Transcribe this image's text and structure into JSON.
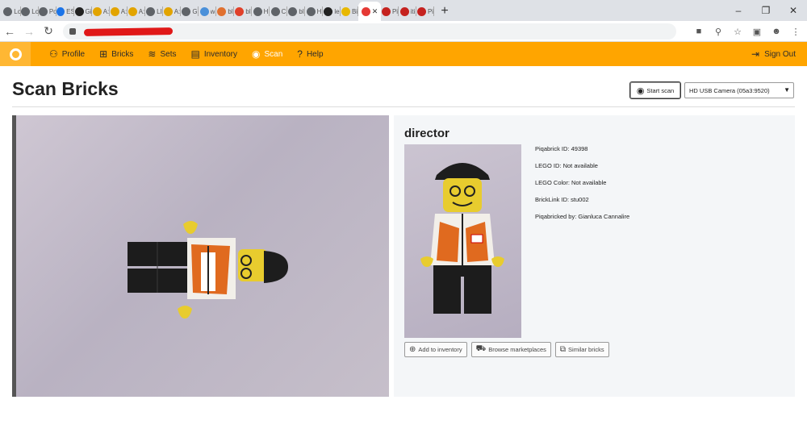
{
  "browser": {
    "tabs": [
      {
        "label": "Lc",
        "color": "#5f6368"
      },
      {
        "label": "Lc",
        "color": "#5f6368"
      },
      {
        "label": "Pc",
        "color": "#5f6368"
      },
      {
        "label": "ES",
        "color": "#1a73e8"
      },
      {
        "label": "Gi",
        "color": "#222222"
      },
      {
        "label": "A:",
        "color": "#e2a400"
      },
      {
        "label": "A:",
        "color": "#e2a400"
      },
      {
        "label": "A:",
        "color": "#e2a400"
      },
      {
        "label": "LI",
        "color": "#5f6368"
      },
      {
        "label": "A:",
        "color": "#e2a400"
      },
      {
        "label": "G",
        "color": "#5f6368"
      },
      {
        "label": "w",
        "color": "#4a90d9"
      },
      {
        "label": "bl",
        "color": "#e07030"
      },
      {
        "label": "bl",
        "color": "#e0402a"
      },
      {
        "label": "H",
        "color": "#5f6368"
      },
      {
        "label": "C",
        "color": "#5f6368"
      },
      {
        "label": "bl",
        "color": "#5f6368"
      },
      {
        "label": "H",
        "color": "#5f6368"
      },
      {
        "label": "le",
        "color": "#222222"
      },
      {
        "label": "Bi",
        "color": "#e8b800"
      }
    ],
    "active_tab_color": "#e53935",
    "trailing_tabs": [
      {
        "label": "Pi",
        "color": "#c5221f"
      },
      {
        "label": "iti",
        "color": "#c5221f"
      },
      {
        "label": "Pi",
        "color": "#c5221f"
      }
    ],
    "new_tab": "+",
    "window_controls": {
      "minimize": "–",
      "maximize": "❐",
      "close": "✕"
    }
  },
  "nav": {
    "items": [
      {
        "label": "Profile",
        "icon": "person-icon",
        "glyph": "⚇"
      },
      {
        "label": "Bricks",
        "icon": "grid-icon",
        "glyph": "⊞"
      },
      {
        "label": "Sets",
        "icon": "layers-icon",
        "glyph": "≋"
      },
      {
        "label": "Inventory",
        "icon": "archive-icon",
        "glyph": "▤"
      },
      {
        "label": "Scan",
        "icon": "eye-icon",
        "glyph": "◉"
      },
      {
        "label": "Help",
        "icon": "help-icon",
        "glyph": "?"
      }
    ],
    "active": "Scan",
    "signout": "Sign Out",
    "signout_icon": "⇥",
    "accent": "#ffa500"
  },
  "page": {
    "title": "Scan Bricks",
    "start_scan": "Start scan",
    "camera": "HD USB Camera (05a3:9520)"
  },
  "brick": {
    "name": "director",
    "details": [
      "Piqabrick ID: 49398",
      "LEGO ID: Not available",
      "LEGO Color: Not available",
      "BrickLink ID: stu002",
      "Piqabricked by: Gianluca Cannalire"
    ],
    "actions": [
      {
        "label": "Add to inventory",
        "icon": "add-circle-icon",
        "glyph": "⊕"
      },
      {
        "label": "Browse marketplaces",
        "icon": "cart-icon",
        "glyph": "⛟"
      },
      {
        "label": "Similar bricks",
        "icon": "copy-icon",
        "glyph": "⧉"
      }
    ]
  }
}
